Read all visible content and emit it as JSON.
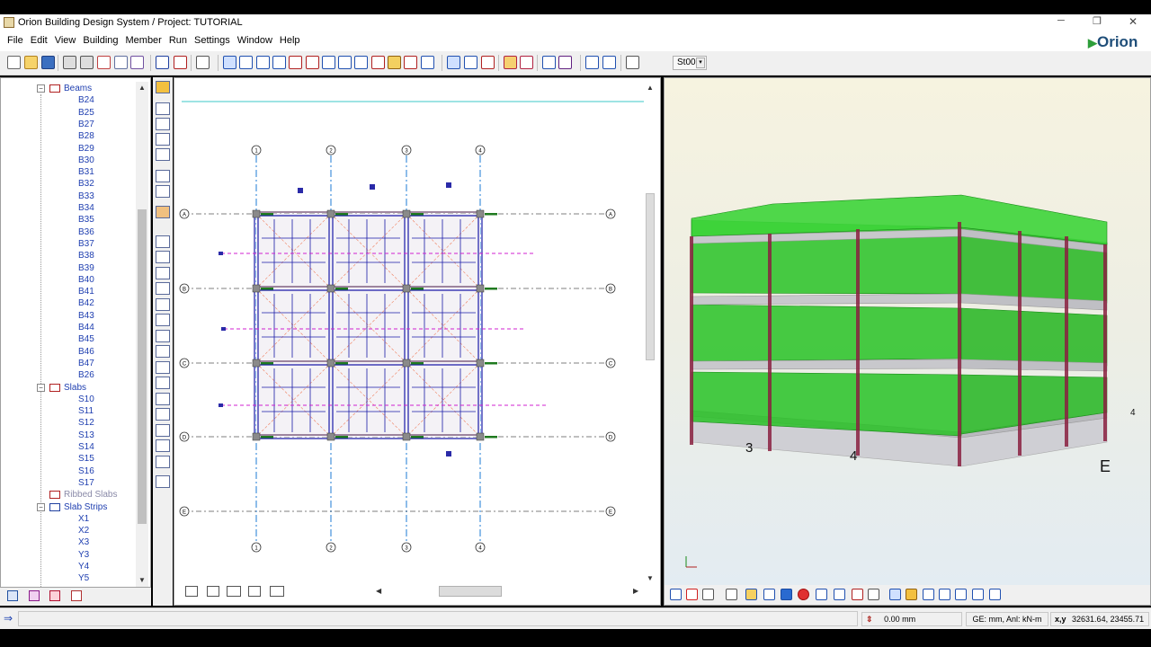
{
  "window": {
    "title": "Orion Building Design System / Project: TUTORIAL",
    "brand": "Orion",
    "controls": {
      "minimize": "─",
      "restore": "❐",
      "close": "✕"
    }
  },
  "menu": [
    "File",
    "Edit",
    "View",
    "Building",
    "Member",
    "Run",
    "Settings",
    "Window",
    "Help"
  ],
  "toolbar": {
    "storey_select": "St00"
  },
  "tree": {
    "beams_label": "Beams",
    "beams": [
      "B24",
      "B25",
      "B27",
      "B28",
      "B29",
      "B30",
      "B31",
      "B32",
      "B33",
      "B34",
      "B35",
      "B36",
      "B37",
      "B38",
      "B39",
      "B40",
      "B41",
      "B42",
      "B43",
      "B44",
      "B45",
      "B46",
      "B47",
      "B26"
    ],
    "slabs_label": "Slabs",
    "slabs": [
      "S10",
      "S11",
      "S12",
      "S13",
      "S14",
      "S15",
      "S16",
      "S17"
    ],
    "ribbed_label": "Ribbed Slabs",
    "strips_label": "Slab Strips",
    "strips": [
      "X1",
      "X2",
      "X3",
      "Y3",
      "Y4",
      "Y5"
    ]
  },
  "plan": {
    "axes_top": [
      "1",
      "2",
      "3",
      "4"
    ],
    "axes_left": [
      "A",
      "B",
      "C",
      "D",
      "E"
    ]
  },
  "view3d": {
    "labels": {
      "l3": "3",
      "l4": "4",
      "lE": "E",
      "l4b": "4"
    }
  },
  "status": {
    "elevation": "0.00 mm",
    "units": "GE: mm, Anl: kN-m",
    "coord_label": "x,y",
    "coords": "32631.64, 23455.71"
  },
  "colors": {
    "grid_axis": "#1e7bd6",
    "beam": "#1a1aa8",
    "column": "#1f7a1f",
    "load": "#d020d0",
    "slab_glass": "#22c41f",
    "column_3d": "#8a2040"
  }
}
